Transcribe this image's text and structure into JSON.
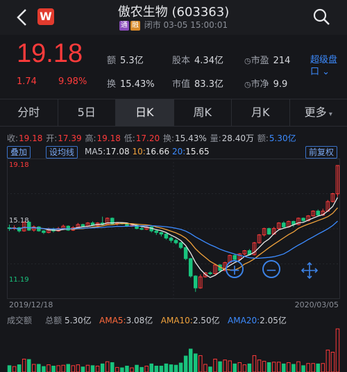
{
  "header": {
    "title": "傲农生物 (603363)",
    "badge_tong": "通",
    "badge_rong": "融",
    "status": "闭市 03-05 15:00:01",
    "logo_letter": "W"
  },
  "quote": {
    "price": "19.18",
    "change": "1.74",
    "change_pct": "9.98%",
    "amount_label": "额",
    "amount": "5.3亿",
    "turnover_label": "换",
    "turnover": "15.43%",
    "share_label": "股本",
    "share": "4.34亿",
    "mktcap_label": "市值",
    "mktcap": "83.3亿",
    "pe_label": "市盈",
    "pe": "214",
    "pb_label": "市净",
    "pb": "9.9",
    "super_label": "超级盘口"
  },
  "tabs": [
    "分时",
    "5日",
    "日K",
    "周K",
    "月K",
    "更多"
  ],
  "info": {
    "close_label": "收:",
    "close": "19.18",
    "open_label": "开:",
    "open": "17.39",
    "high_label": "高:",
    "high": "19.18",
    "low_label": "低:",
    "low": "17.20",
    "turn_label": "换:",
    "turn": "15.43%",
    "vol_label": "量:",
    "vol": "28.40万",
    "amt_label": "额:",
    "amt": "5.30亿"
  },
  "controls": {
    "overlay": "叠加",
    "ma_setting": "设均线",
    "adjust": "前复权"
  },
  "ma": {
    "ma5_label": "MA5:",
    "ma5": "17.08",
    "ma10_label": "10:",
    "ma10": "16.66",
    "ma20_label": "20:",
    "ma20": "15.65"
  },
  "chart": {
    "y_top": "19.18",
    "y_mid": "15.18",
    "y_bottom": "11.19",
    "date_start": "2019/12/18",
    "date_end": "2020/03/05"
  },
  "volume": {
    "title": "成交额",
    "total_label": "总额",
    "total": "5.30亿",
    "ama5_label": "AMA5:",
    "ama5": "3.08亿",
    "ama10_label": "AMA10:",
    "ama10": "2.50亿",
    "ama20_label": "AMA20:",
    "ama20": "2.05亿"
  },
  "colors": {
    "up": "#ff3b3b",
    "down": "#19c37d",
    "ma5": "#e8e8e8",
    "ma10": "#f0a23c",
    "ma20": "#3c8bff",
    "accent": "#3c8bff"
  },
  "chart_data": {
    "type": "candlestick",
    "ylim": [
      11.19,
      19.18
    ],
    "candles": [
      [
        15.25,
        15.2,
        15.45,
        15.05
      ],
      [
        15.2,
        15.25,
        15.4,
        15.1
      ],
      [
        15.25,
        15.05,
        15.3,
        14.95
      ],
      [
        15.05,
        15.6,
        15.65,
        15.0
      ],
      [
        15.6,
        15.1,
        15.7,
        15.05
      ],
      [
        15.1,
        15.3,
        15.4,
        15.0
      ],
      [
        15.3,
        15.05,
        15.35,
        15.0
      ],
      [
        15.05,
        14.95,
        15.1,
        14.85
      ],
      [
        14.95,
        15.15,
        15.25,
        14.9
      ],
      [
        15.15,
        15.05,
        15.25,
        14.95
      ],
      [
        15.05,
        15.2,
        15.3,
        15.0
      ],
      [
        15.2,
        15.35,
        15.45,
        15.1
      ],
      [
        15.35,
        15.1,
        15.4,
        15.05
      ],
      [
        15.1,
        15.25,
        15.35,
        15.05
      ],
      [
        15.25,
        15.45,
        15.55,
        15.2
      ],
      [
        15.45,
        15.35,
        15.5,
        15.3
      ],
      [
        15.35,
        15.55,
        15.6,
        15.3
      ],
      [
        15.55,
        15.4,
        15.65,
        15.35
      ],
      [
        15.4,
        15.55,
        15.6,
        15.35
      ],
      [
        15.55,
        15.45,
        15.95,
        15.4
      ],
      [
        15.45,
        15.85,
        15.9,
        15.4
      ],
      [
        15.85,
        15.5,
        15.9,
        15.45
      ],
      [
        15.5,
        15.55,
        15.6,
        15.4
      ],
      [
        15.55,
        15.5,
        15.6,
        15.45
      ],
      [
        15.5,
        15.35,
        15.55,
        15.3
      ],
      [
        15.35,
        15.4,
        15.45,
        15.3
      ],
      [
        15.4,
        15.2,
        15.45,
        15.15
      ],
      [
        15.2,
        15.15,
        15.3,
        15.1
      ],
      [
        15.15,
        15.3,
        15.35,
        15.1
      ],
      [
        15.3,
        15.05,
        15.35,
        14.95
      ],
      [
        15.05,
        14.95,
        15.1,
        14.8
      ],
      [
        14.95,
        14.85,
        15.0,
        14.7
      ],
      [
        14.85,
        14.6,
        14.9,
        14.5
      ],
      [
        14.6,
        14.45,
        14.7,
        14.3
      ],
      [
        14.45,
        14.3,
        14.55,
        14.2
      ],
      [
        14.3,
        14.0,
        14.35,
        13.9
      ],
      [
        14.0,
        13.3,
        14.05,
        13.2
      ],
      [
        13.3,
        12.2,
        13.35,
        12.1
      ],
      [
        12.2,
        11.45,
        12.25,
        11.2
      ],
      [
        11.45,
        12.15,
        12.3,
        11.4
      ],
      [
        12.15,
        12.4,
        12.45,
        12.1
      ],
      [
        12.4,
        12.35,
        12.5,
        12.25
      ],
      [
        12.35,
        12.9,
        12.95,
        12.3
      ],
      [
        12.9,
        12.55,
        12.95,
        12.4
      ],
      [
        12.55,
        13.05,
        13.1,
        12.5
      ],
      [
        13.05,
        13.5,
        13.55,
        13.0
      ],
      [
        13.5,
        13.25,
        13.6,
        13.2
      ],
      [
        13.25,
        13.6,
        13.65,
        13.2
      ],
      [
        13.6,
        13.8,
        13.85,
        13.5
      ],
      [
        13.8,
        13.55,
        13.9,
        13.5
      ],
      [
        13.55,
        14.3,
        14.35,
        13.5
      ],
      [
        14.3,
        14.8,
        14.85,
        14.25
      ],
      [
        14.8,
        15.2,
        15.25,
        14.7
      ],
      [
        15.2,
        14.85,
        15.25,
        14.8
      ],
      [
        14.85,
        15.2,
        15.3,
        14.8
      ],
      [
        15.2,
        15.55,
        15.6,
        15.1
      ],
      [
        15.55,
        15.3,
        15.65,
        15.25
      ],
      [
        15.3,
        15.65,
        15.7,
        15.25
      ],
      [
        15.65,
        15.45,
        15.7,
        15.3
      ],
      [
        15.45,
        15.85,
        15.9,
        15.4
      ],
      [
        15.85,
        15.7,
        15.9,
        15.6
      ],
      [
        15.7,
        16.0,
        16.05,
        15.65
      ],
      [
        16.0,
        16.3,
        16.35,
        15.95
      ],
      [
        16.3,
        16.05,
        16.4,
        16.0
      ],
      [
        16.05,
        16.3,
        16.45,
        16.0
      ],
      [
        16.3,
        16.9,
        17.0,
        16.25
      ],
      [
        16.9,
        17.4,
        17.45,
        16.85
      ],
      [
        17.39,
        19.18,
        19.18,
        17.2
      ]
    ]
  }
}
